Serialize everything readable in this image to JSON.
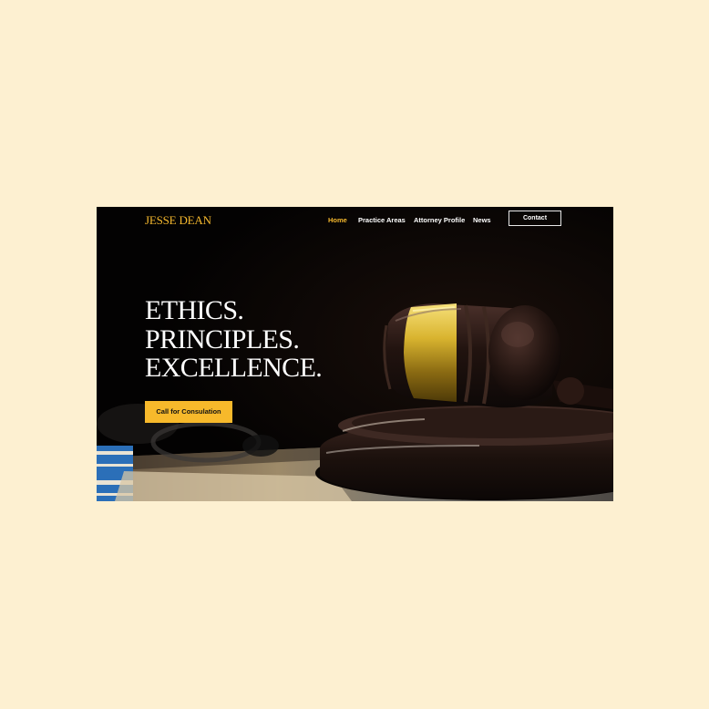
{
  "colors": {
    "page_background": "#fdf0d1",
    "accent": "#f5b82e",
    "hero_background": "#050404"
  },
  "brand": {
    "name": "JESSE DEAN"
  },
  "nav": {
    "items": [
      {
        "label": "Home",
        "active": true
      },
      {
        "label": "Practice Areas",
        "active": false
      },
      {
        "label": "Attorney Profile",
        "active": false
      },
      {
        "label": "News",
        "active": false
      }
    ],
    "contact_label": "Contact"
  },
  "hero": {
    "headline_lines": [
      "ETHICS.",
      "PRINCIPLES.",
      "EXCELLENCE."
    ],
    "cta_label": "Call for Consulation",
    "image_subject": "gavel-photo"
  }
}
